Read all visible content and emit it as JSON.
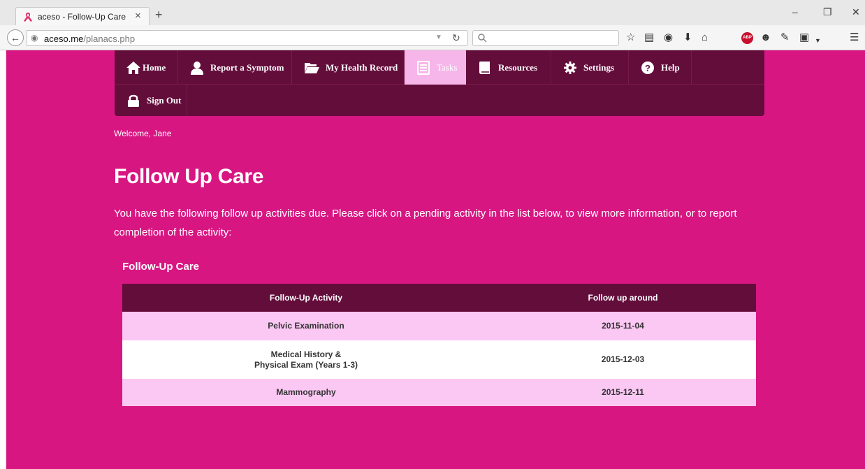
{
  "browser": {
    "tab_title": "aceso - Follow-Up Care",
    "tab_close": "×",
    "new_tab": "+",
    "url_host": "aceso.me",
    "url_path": "/planacs.php",
    "window_minimize": "–",
    "window_restore": "❐",
    "window_close": "✕"
  },
  "nav": {
    "home": "Home",
    "report_symptom": "Report a Symptom",
    "health_record": "My Health Record",
    "tasks": "Tasks",
    "resources": "Resources",
    "settings": "Settings",
    "help": "Help",
    "sign_out": "Sign Out"
  },
  "welcome": "Welcome, Jane",
  "page_title": "Follow Up Care",
  "intro": "You have the following follow up activities due. Please click on a pending activity in the list below, to view more information, or to report completion of the activity:",
  "table": {
    "caption": "Follow-Up Care",
    "headers": [
      "Follow-Up Activity",
      "Follow up around"
    ],
    "rows": [
      {
        "activity_line1": "Pelvic Examination",
        "activity_line2": "",
        "date": "2015-11-04"
      },
      {
        "activity_line1": "Medical History &",
        "activity_line2": "Physical Exam (Years 1-3)",
        "date": "2015-12-03"
      },
      {
        "activity_line1": "Mammography",
        "activity_line2": "",
        "date": "2015-12-11"
      }
    ]
  },
  "colors": {
    "page_background": "#d81682",
    "nav_background": "#630d3b",
    "nav_active": "#f7b6ea",
    "row_pink": "#fbc7f3",
    "row_white": "#ffffff"
  }
}
